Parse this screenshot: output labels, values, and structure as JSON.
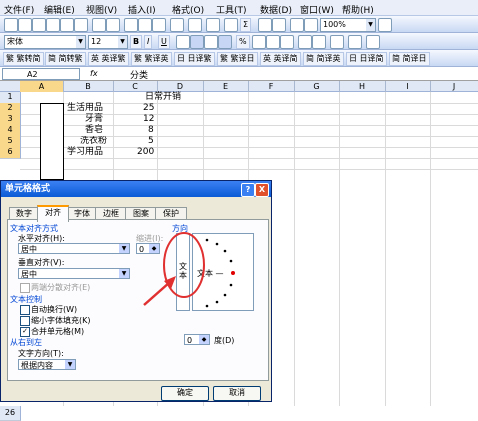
{
  "menu": [
    "文件(F)",
    "编辑(E)",
    "视图(V)",
    "插入(I)",
    "格式(O)",
    "工具(T)",
    "数据(D)",
    "窗口(W)",
    "帮助(H)"
  ],
  "toolbar": {
    "zoom": "100%",
    "font_name": "宋体",
    "font_size": "12",
    "bold": "B",
    "italic": "I",
    "underline": "U",
    "sigma": "Σ",
    "percent": "%",
    "translate_buttons": [
      "繁 繁转简",
      "简 简转繁",
      "英 英译繁",
      "繁 繁译英",
      "日 日译繁",
      "繁 繁译日",
      "英 英译简",
      "简 简译英",
      "日 日译简",
      "简 简译日"
    ]
  },
  "formula_bar": {
    "name_box": "A2",
    "fx": "fx",
    "value": "分类"
  },
  "columns": [
    "A",
    "B",
    "C",
    "D",
    "E",
    "F",
    "G",
    "H",
    "I",
    "J"
  ],
  "rows": [
    {
      "num": "1",
      "b": "",
      "c": "",
      "d": "日常开销"
    },
    {
      "num": "2",
      "b": "生活用品",
      "c": "25",
      "d": ""
    },
    {
      "num": "3",
      "b": "牙膏",
      "c": "12",
      "d": ""
    },
    {
      "num": "4",
      "b": "香皂",
      "c": "8",
      "d": ""
    },
    {
      "num": "5",
      "b": "洗衣粉",
      "c": "5",
      "d": ""
    },
    {
      "num": "6",
      "b": "学习用品",
      "c": "200",
      "d": ""
    }
  ],
  "last_row": "26",
  "dialog": {
    "title": "单元格格式",
    "tabs": [
      "数字",
      "对齐",
      "字体",
      "边框",
      "图案",
      "保护"
    ],
    "active_tab": "对齐",
    "section_alignment": "文本对齐方式",
    "h_align_label": "水平对齐(H):",
    "h_align_value": "居中",
    "indent_label": "缩进(I):",
    "indent_value": "0",
    "v_align_label": "垂直对齐(V):",
    "v_align_value": "居中",
    "justify_distributed": "两端分散对齐(E)",
    "section_control": "文本控制",
    "wrap_text": "自动换行(W)",
    "shrink_fit": "缩小字体填充(K)",
    "merge_cells": "合并单元格(M)",
    "section_rtl": "从右到左",
    "text_direction_label": "文字方向(T):",
    "text_direction_value": "根据内容",
    "orientation_label": "方向",
    "vertical_text": "文本",
    "horizontal_text": "文本 —",
    "degree_value": "0",
    "degree_label": "度(D)",
    "ok": "确定",
    "cancel": "取消",
    "help": "?",
    "close": "X"
  },
  "colors": {
    "accent": "#0a5bd6",
    "arrow": "#e03030",
    "circle": "#e03030"
  }
}
